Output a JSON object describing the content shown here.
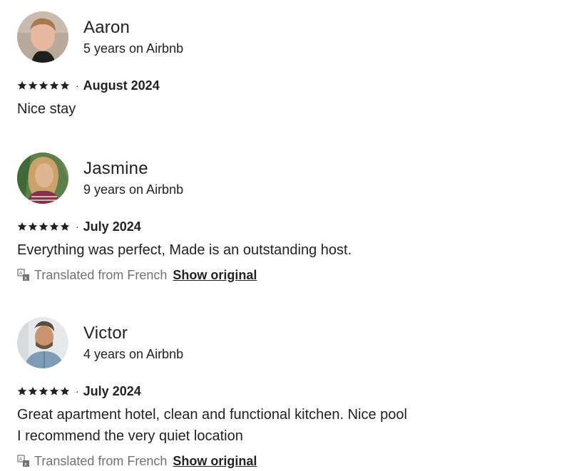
{
  "reviews": [
    {
      "name": "Aaron",
      "tenure": "5 years on Airbnb",
      "rating": 5,
      "dot": "·",
      "date": "August 2024",
      "text_lines": [
        "Nice stay"
      ],
      "translated": false,
      "avatar_icon": "avatar-photo-aaron"
    },
    {
      "name": "Jasmine",
      "tenure": "9 years on Airbnb",
      "rating": 5,
      "dot": "·",
      "date": "July 2024",
      "text_lines": [
        "Everything was perfect, Made is an outstanding host."
      ],
      "translated": true,
      "translated_label": "Translated from French",
      "show_original_label": "Show original",
      "avatar_icon": "avatar-photo-jasmine"
    },
    {
      "name": "Victor",
      "tenure": "4 years on Airbnb",
      "rating": 5,
      "dot": "·",
      "date": "July 2024",
      "text_lines": [
        "Great apartment hotel, clean and functional kitchen. Nice pool",
        "I recommend the very quiet location"
      ],
      "translated": true,
      "translated_label": "Translated from French",
      "show_original_label": "Show original",
      "avatar_icon": "avatar-photo-victor"
    }
  ],
  "colors": {
    "text": "#222222",
    "muted": "#717171"
  }
}
